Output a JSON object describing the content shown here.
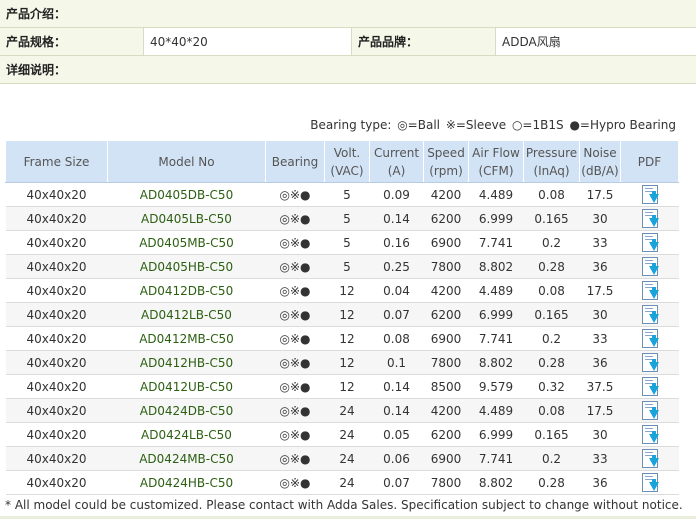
{
  "info": {
    "intro_label": "产品介绍：",
    "spec_label": "产品规格：",
    "spec_value": "40*40*20",
    "brand_label": "产品品牌：",
    "brand_value": "ADDA风扇",
    "detail_label": "详细说明："
  },
  "legend": {
    "prefix": "Bearing type:",
    "items": [
      "◎=Ball",
      "※=Sleeve",
      "○=1B1S",
      "●=Hypro Bearing"
    ]
  },
  "table": {
    "headers": [
      [
        "Frame Size",
        ""
      ],
      [
        "Model No",
        ""
      ],
      [
        "Bearing",
        ""
      ],
      [
        "Volt.",
        "(VAC)"
      ],
      [
        "Current",
        "(A)"
      ],
      [
        "Speed",
        "(rpm)"
      ],
      [
        "Air Flow",
        "(CFM)"
      ],
      [
        "Pressure",
        "(InAq)"
      ],
      [
        "Noise",
        "(dB/A)"
      ],
      [
        "PDF",
        ""
      ]
    ],
    "rows": [
      [
        "40x40x20",
        "AD0405DB-C50",
        "◎※●",
        "5",
        "0.09",
        "4200",
        "4.489",
        "0.08",
        "17.5"
      ],
      [
        "40x40x20",
        "AD0405LB-C50",
        "◎※●",
        "5",
        "0.14",
        "6200",
        "6.999",
        "0.165",
        "30"
      ],
      [
        "40x40x20",
        "AD0405MB-C50",
        "◎※●",
        "5",
        "0.16",
        "6900",
        "7.741",
        "0.2",
        "33"
      ],
      [
        "40x40x20",
        "AD0405HB-C50",
        "◎※●",
        "5",
        "0.25",
        "7800",
        "8.802",
        "0.28",
        "36"
      ],
      [
        "40x40x20",
        "AD0412DB-C50",
        "◎※●",
        "12",
        "0.04",
        "4200",
        "4.489",
        "0.08",
        "17.5"
      ],
      [
        "40x40x20",
        "AD0412LB-C50",
        "◎※●",
        "12",
        "0.07",
        "6200",
        "6.999",
        "0.165",
        "30"
      ],
      [
        "40x40x20",
        "AD0412MB-C50",
        "◎※●",
        "12",
        "0.08",
        "6900",
        "7.741",
        "0.2",
        "33"
      ],
      [
        "40x40x20",
        "AD0412HB-C50",
        "◎※●",
        "12",
        "0.1",
        "7800",
        "8.802",
        "0.28",
        "36"
      ],
      [
        "40x40x20",
        "AD0412UB-C50",
        "◎※●",
        "12",
        "0.14",
        "8500",
        "9.579",
        "0.32",
        "37.5"
      ],
      [
        "40x40x20",
        "AD0424DB-C50",
        "◎※●",
        "24",
        "0.14",
        "4200",
        "4.489",
        "0.08",
        "17.5"
      ],
      [
        "40x40x20",
        "AD0424LB-C50",
        "◎※●",
        "24",
        "0.05",
        "6200",
        "6.999",
        "0.165",
        "30"
      ],
      [
        "40x40x20",
        "AD0424MB-C50",
        "◎※●",
        "24",
        "0.06",
        "6900",
        "7.741",
        "0.2",
        "33"
      ],
      [
        "40x40x20",
        "AD0424HB-C50",
        "◎※●",
        "24",
        "0.07",
        "7800",
        "8.802",
        "0.28",
        "36"
      ]
    ]
  },
  "footnote": "* All model could be customized. Please contact with Adda Sales. Specification subject to change without notice.",
  "colors": {
    "header_bg": "#d2e3f5",
    "model_text": "#2b5f12",
    "pdf_arrow": "#19a3d8",
    "info_bg": "#f5f7e9"
  },
  "icons": {
    "pdf": "pdf-download-icon"
  }
}
